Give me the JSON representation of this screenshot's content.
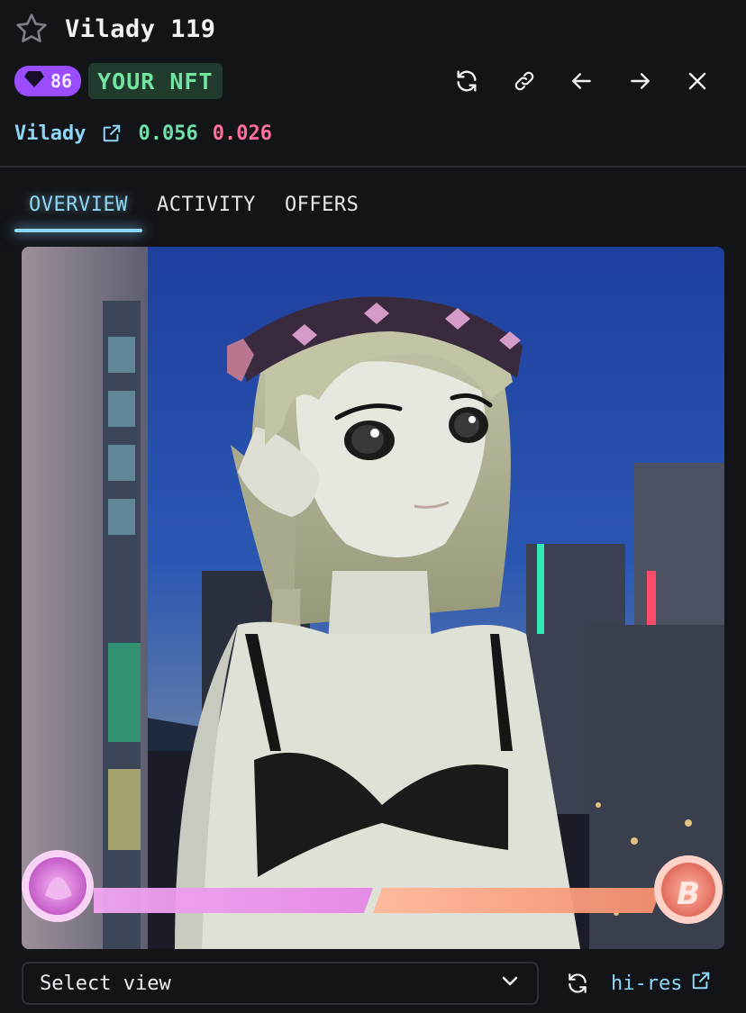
{
  "header": {
    "title": "Vilady 119",
    "rank": "86",
    "your_nft_label": "YOUR NFT"
  },
  "collection": {
    "name": "Vilady",
    "price_green": "0.056",
    "price_pink": "0.026"
  },
  "tabs": [
    {
      "label": "OVERVIEW",
      "active": true
    },
    {
      "label": "ACTIVITY",
      "active": false
    },
    {
      "label": "OFFERS",
      "active": false
    }
  ],
  "bottom": {
    "select_value": "Select view",
    "hires_label": "hi-res"
  },
  "icons": [
    "star-icon",
    "diamond-icon",
    "refresh-icon",
    "link-icon",
    "arrow-left-icon",
    "arrow-right-icon",
    "close-icon",
    "external-link-icon",
    "chevron-down-icon"
  ],
  "colors": {
    "background": "#131418",
    "accent_blue": "#8fd6f5",
    "accent_green": "#6fe0a8",
    "accent_pink": "#ff6f9b",
    "rank_purple": "#9b4cff",
    "nft_badge_bg": "#203a2d",
    "nft_badge_text": "#71e4a2"
  }
}
